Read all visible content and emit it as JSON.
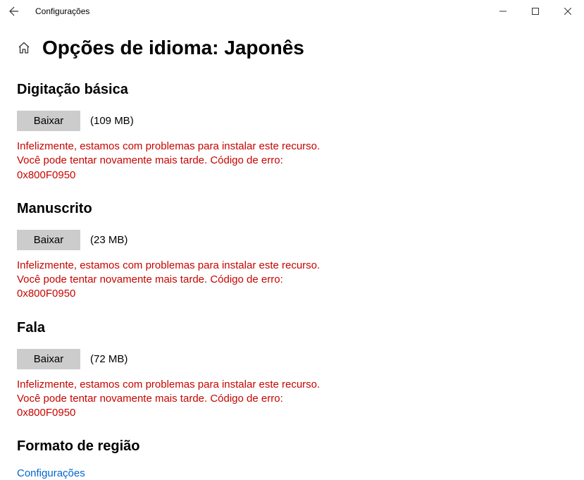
{
  "titlebar": {
    "title": "Configurações"
  },
  "page": {
    "title": "Opções de idioma: Japonês"
  },
  "sections": [
    {
      "heading": "Digitação básica",
      "button_label": "Baixar",
      "size": "(109 MB)",
      "error": "Infelizmente, estamos com problemas para instalar este recurso. Você pode tentar novamente mais tarde. Código de erro: 0x800F0950"
    },
    {
      "heading": "Manuscrito",
      "button_label": "Baixar",
      "size": "(23 MB)",
      "error": "Infelizmente, estamos com problemas para instalar este recurso. Você pode tentar novamente mais tarde. Código de erro: 0x800F0950"
    },
    {
      "heading": "Fala",
      "button_label": "Baixar",
      "size": "(72 MB)",
      "error": "Infelizmente, estamos com problemas para instalar este recurso. Você pode tentar novamente mais tarde. Código de erro: 0x800F0950"
    }
  ],
  "region": {
    "heading": "Formato de região",
    "link": "Configurações"
  }
}
